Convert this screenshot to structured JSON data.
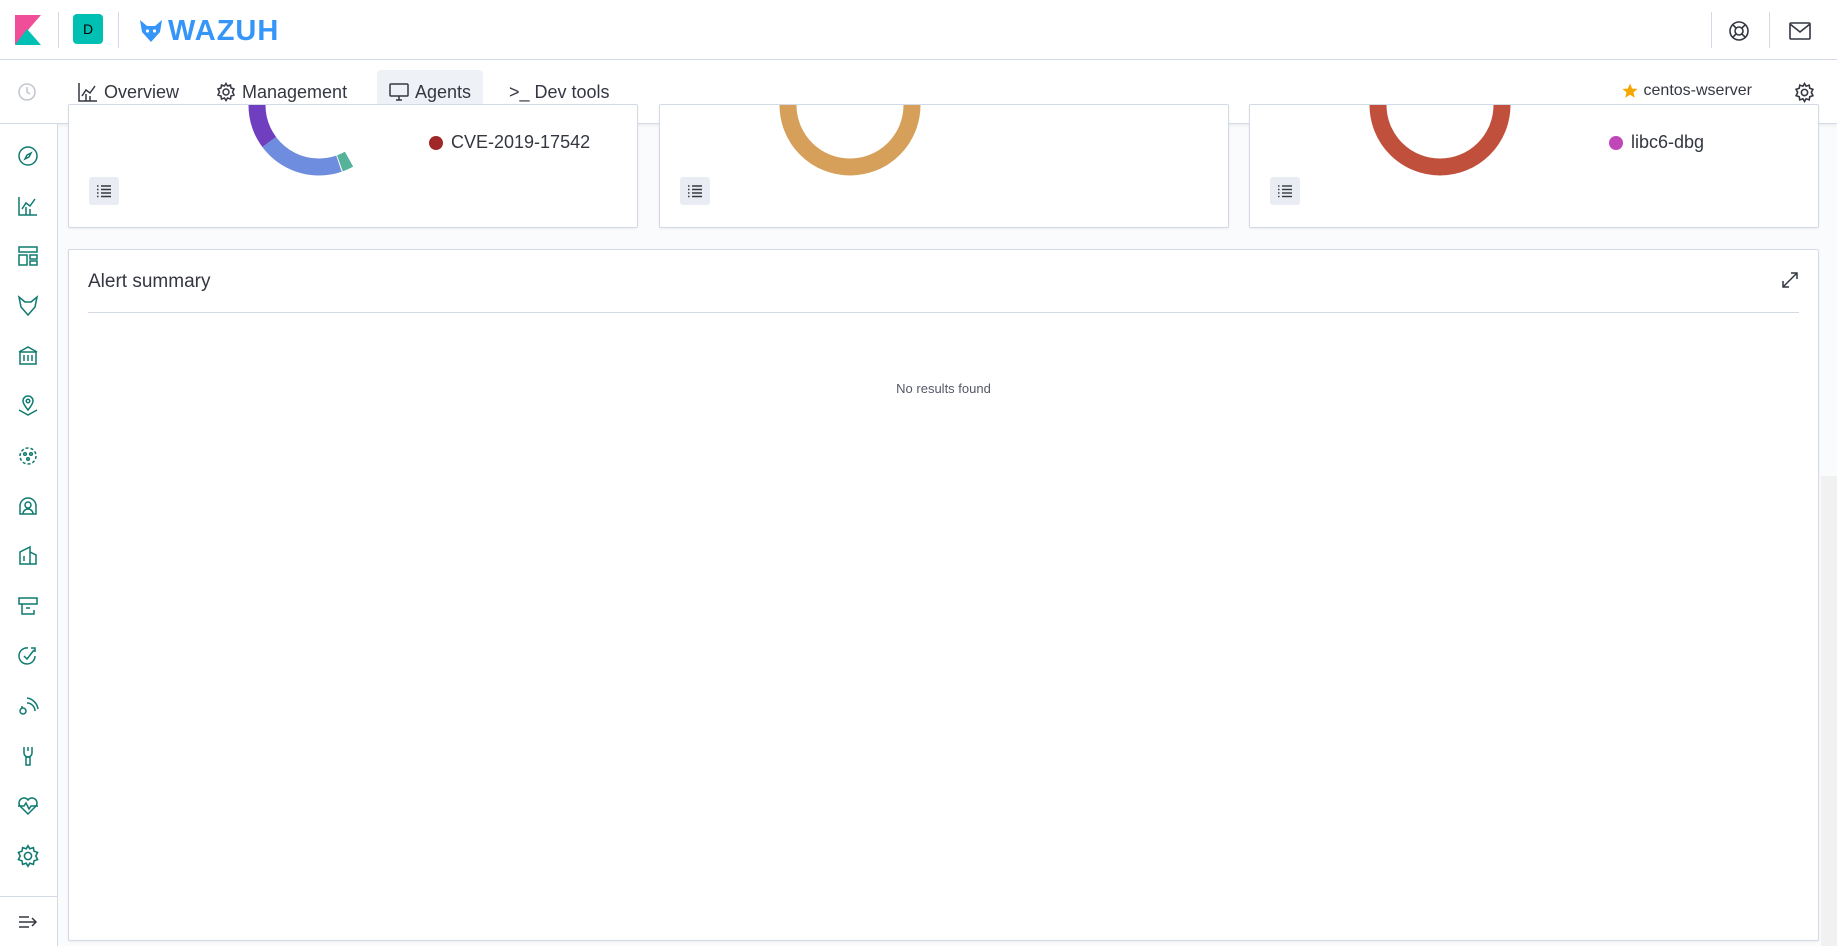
{
  "header": {
    "space_initial": "D",
    "brand_name": "WAZUH"
  },
  "nav": {
    "items": [
      {
        "label": "Overview"
      },
      {
        "label": "Management"
      },
      {
        "label": "Agents"
      },
      {
        "label": ">_ Dev tools"
      }
    ],
    "active": "Agents",
    "agent_name": "centos-wserver"
  },
  "rail": {
    "icons": [
      "compass-icon",
      "chart-icon",
      "layout-icon",
      "wazuh-wolf-icon",
      "bank-icon",
      "map-pin-icon",
      "bug-icon",
      "user-shield-icon",
      "docs-icon",
      "box-icon",
      "check-icon",
      "signal-icon",
      "tool-icon",
      "heartbeat-icon",
      "gear-icon",
      "collapse-icon"
    ]
  },
  "top_panels": [
    {
      "legend_label": "CVE-2019-17542",
      "legend_color": "#a02828"
    },
    {
      "legend_label": "",
      "legend_color": "#d6a05a"
    },
    {
      "legend_label": "libc6-dbg",
      "legend_color": "#c146b8"
    }
  ],
  "alert_summary": {
    "title": "Alert summary",
    "empty_message": "No results found"
  },
  "colors": {
    "accent": "#3595f9",
    "teal": "#00bfb3",
    "star": "#f5a700",
    "donut_purple": "#6f3fc0",
    "donut_blue": "#6f8ddf",
    "donut_green": "#54b399",
    "donut_orange": "#d6a05a",
    "donut_red": "#c0503c"
  }
}
